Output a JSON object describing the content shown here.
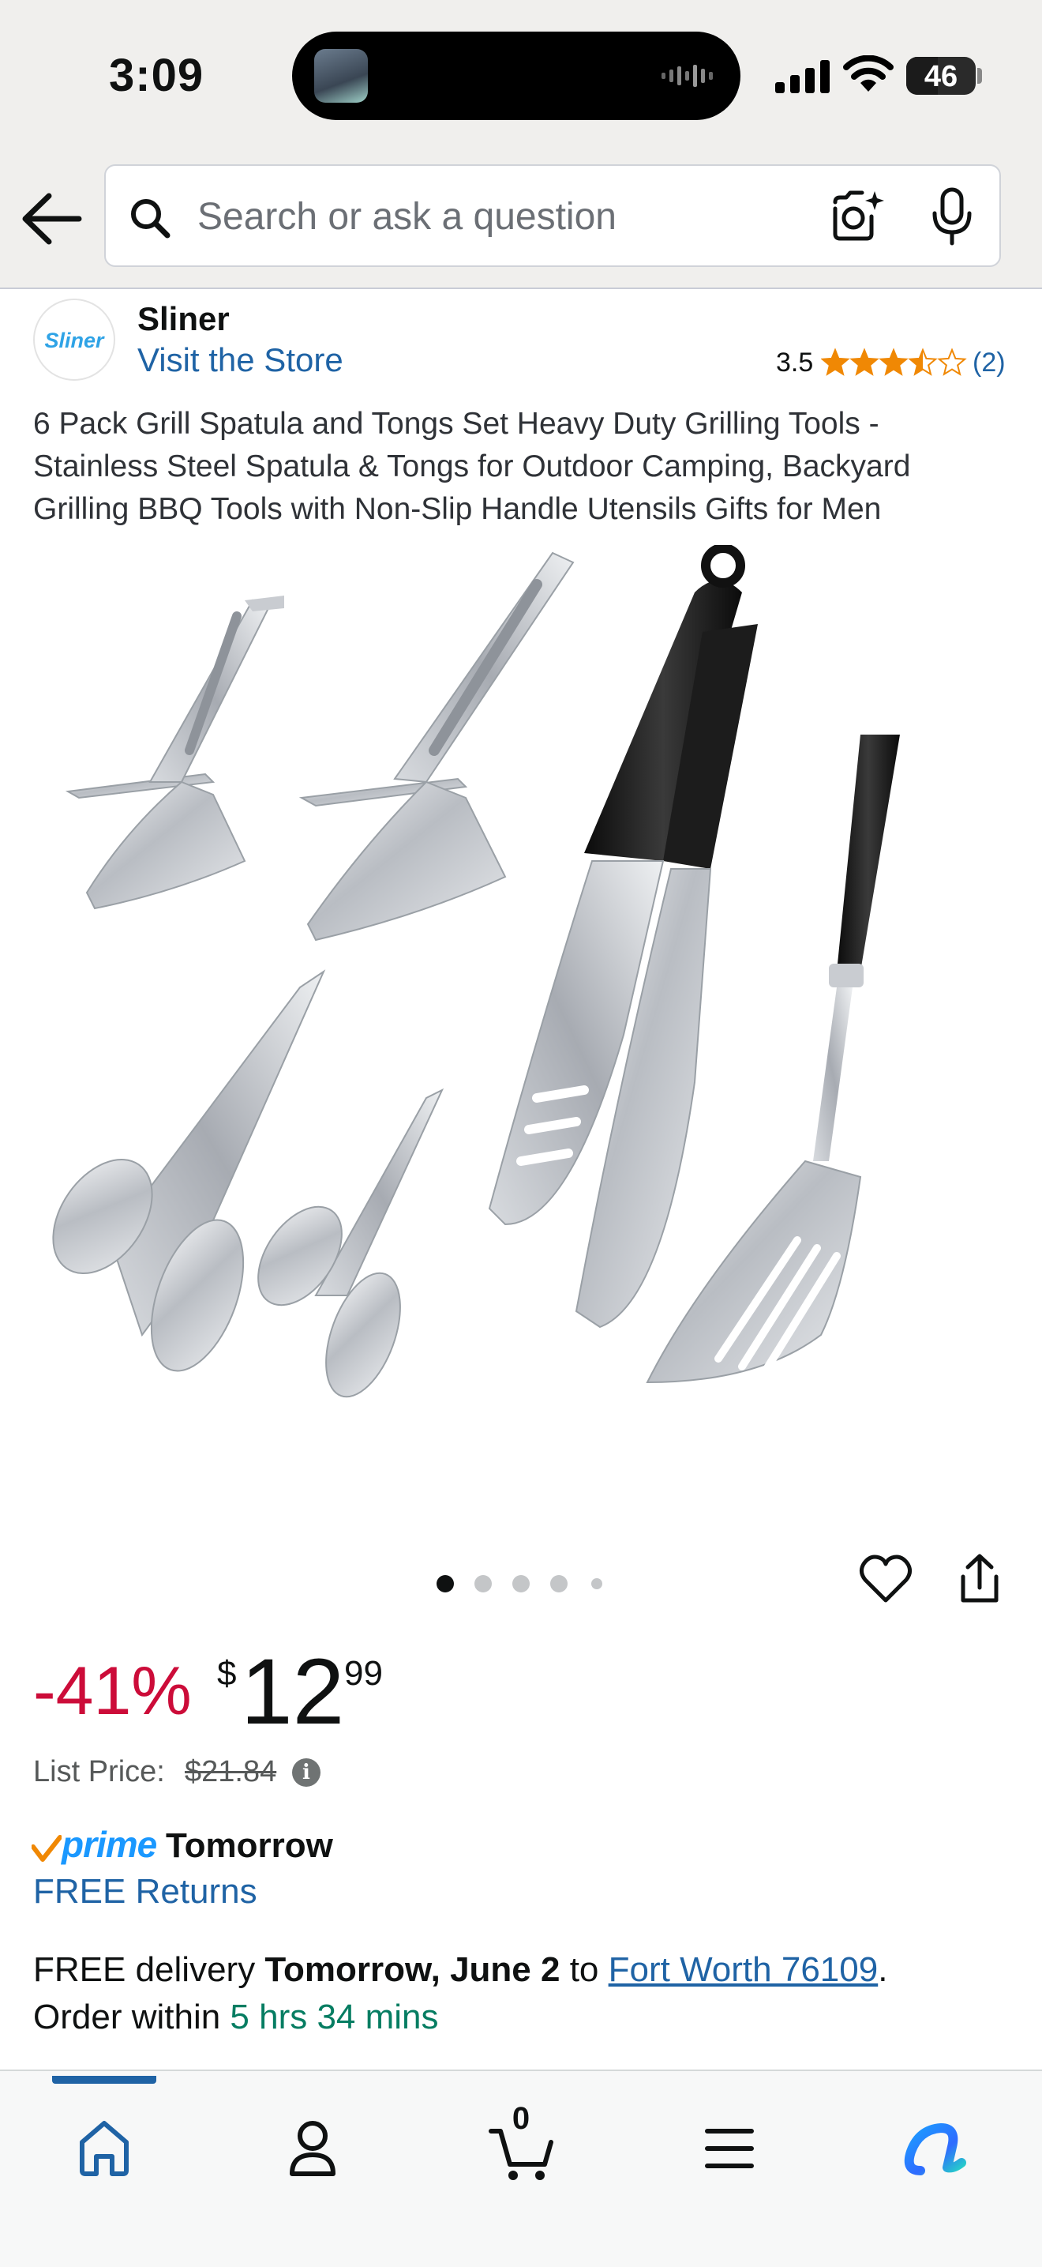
{
  "status_bar": {
    "time": "3:09",
    "battery": "46",
    "battery_level": 0.46
  },
  "search": {
    "placeholder": "Search or ask a question"
  },
  "store": {
    "logo_text": "Sliner",
    "brand": "Sliner",
    "visit_label": "Visit the Store"
  },
  "rating": {
    "value": "3.5",
    "stars": 3.5,
    "count": "(2)"
  },
  "product": {
    "title": "6 Pack Grill Spatula and Tongs Set Heavy Duty Grilling Tools - Stainless Steel Spatula & Tongs for Outdoor Camping, Backyard Grilling BBQ Tools with Non-Slip Handle Utensils Gifts for Men"
  },
  "carousel": {
    "total_images": 5,
    "active_index": 0
  },
  "price": {
    "discount": "-41%",
    "currency": "$",
    "whole": "12",
    "fraction": "99",
    "list_label": "List Price:",
    "list_value": "$21.84"
  },
  "prime": {
    "logo": "prime",
    "label": "Tomorrow",
    "returns": "FREE Returns"
  },
  "delivery": {
    "prefix": "FREE delivery ",
    "date": "Tomorrow, June 2",
    "to": " to ",
    "location": "Fort Worth 76109",
    "period": ".",
    "order_prefix": "Order within ",
    "countdown": "5 hrs 34 mins"
  },
  "bottom_nav": {
    "cart_count": "0"
  },
  "colors": {
    "accent": "#1f63a5",
    "discount": "#cc0c39",
    "star": "#f08804",
    "prime": "#1a98ff",
    "countdown": "#067d62"
  }
}
